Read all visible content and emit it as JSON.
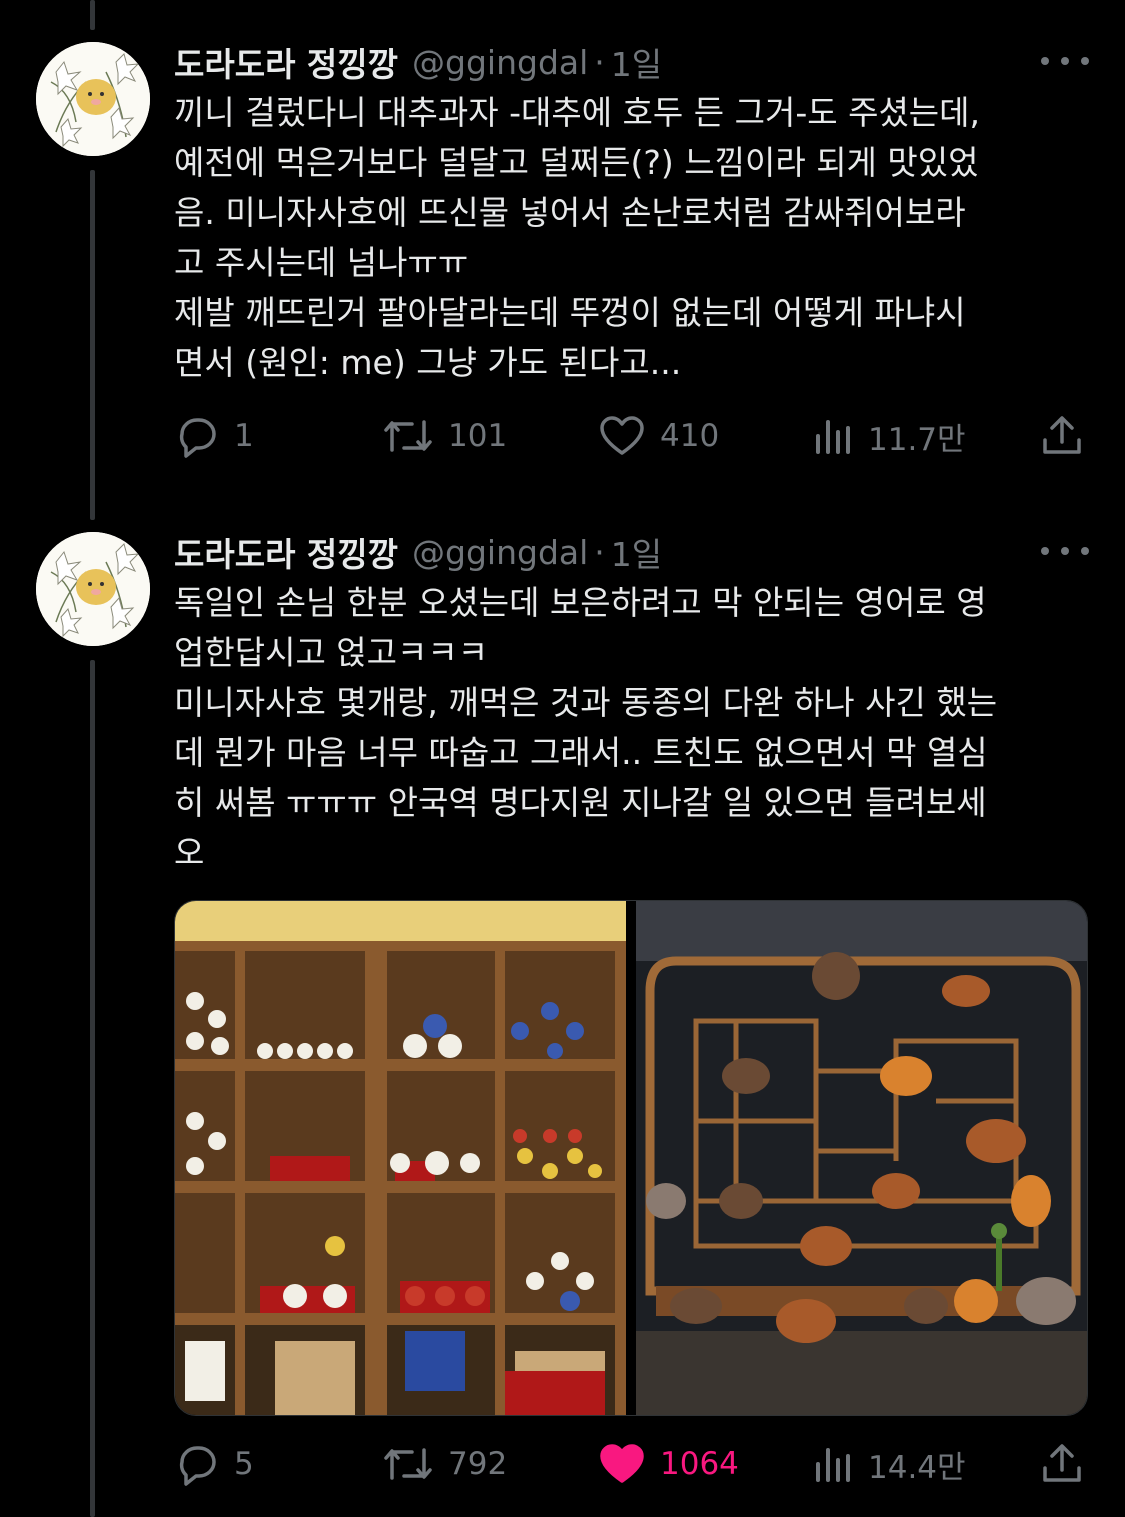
{
  "tweets": [
    {
      "author": {
        "name": "도라도라 정낑깡",
        "handle": "@ggingdal",
        "time": "1일"
      },
      "lines": [
        "끼니 걸렀다니 대추과자 -대추에 호두 든 그거-도 주셨는데,",
        "예전에 먹은거보다 덜달고 덜쩌든(?) 느낌이라 되게 맛있었",
        "음. 미니자사호에 뜨신물 넣어서 손난로처럼 감싸쥐어보라",
        "고 주시는데 넘나ㅠㅠ",
        "제발 깨뜨린거 팔아달라는데 뚜껑이 없는데 어떻게 파냐시",
        "면서  (원인: me) 그냥 가도 된다고..."
      ],
      "stats": {
        "replies": "1",
        "retweets": "101",
        "likes": "410",
        "views": "11.7만"
      },
      "liked": false
    },
    {
      "author": {
        "name": "도라도라 정낑깡",
        "handle": "@ggingdal",
        "time": "1일"
      },
      "lines": [
        "독일인 손님 한분 오셨는데 보은하려고 막 안되는 영어로 영",
        "업한답시고 얹고ㅋㅋㅋ",
        "미니자사호 몇개랑, 깨먹은 것과 동종의 다완 하나 사긴 했는",
        "데 뭔가 마음 너무 따숩고 그래서.. 트친도 없으면서 막 열심",
        "히 써봄 ㅠㅠㅠ 안국역 명다지원 지나갈 일 있으면 들려보세",
        "오"
      ],
      "stats": {
        "replies": "5",
        "retweets": "792",
        "likes": "1064",
        "views": "14.4만"
      },
      "liked": true
    }
  ],
  "colors": {
    "background": "#000000",
    "text": "#e7e9ea",
    "muted": "#71767b",
    "like": "#f91880"
  },
  "icons": [
    "reply-icon",
    "retweet-icon",
    "like-icon",
    "views-icon",
    "share-icon",
    "more-icon"
  ]
}
